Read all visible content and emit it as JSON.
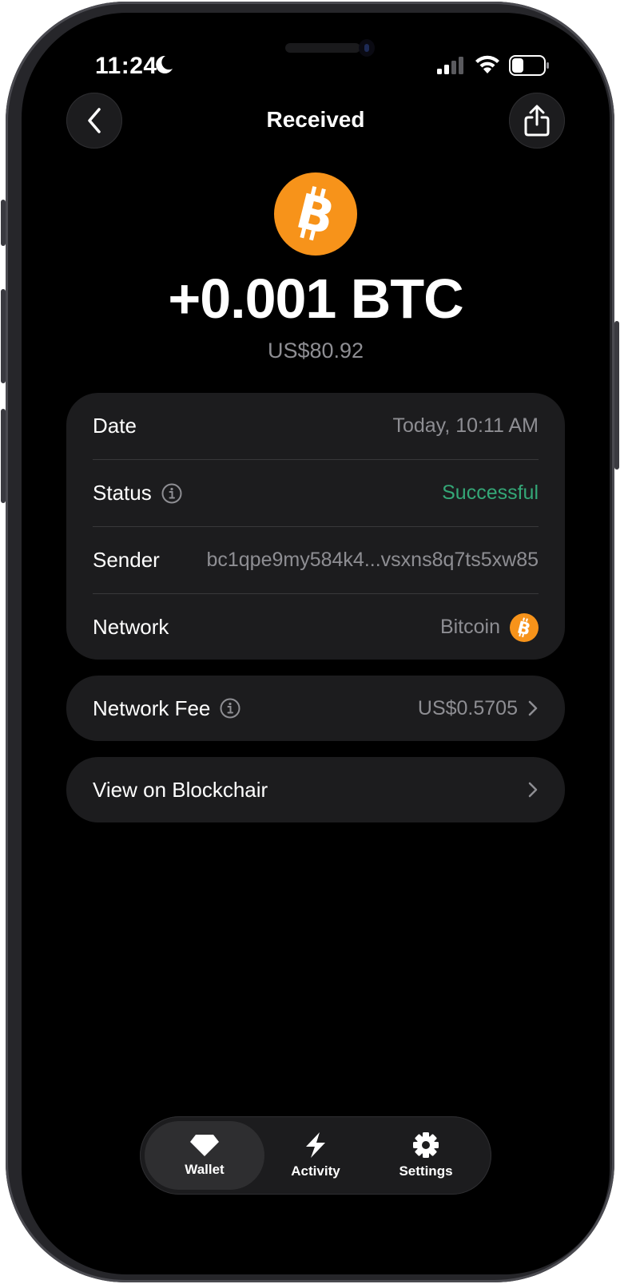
{
  "status_bar": {
    "time": "11:24"
  },
  "nav": {
    "title": "Received"
  },
  "transaction": {
    "amount": "+0.001 BTC",
    "fiat": "US$80.92"
  },
  "details": [
    {
      "label": "Date",
      "value": "Today, 10:11 AM"
    },
    {
      "label": "Status",
      "value": "Successful"
    },
    {
      "label": "Sender",
      "value": "bc1qpe9my584k4...vsxns8q7ts5xw85"
    },
    {
      "label": "Network",
      "value": "Bitcoin"
    }
  ],
  "network_fee": {
    "label": "Network Fee",
    "value": "US$0.5705"
  },
  "explorer": {
    "label": "View on Blockchair"
  },
  "tabs": [
    {
      "label": "Wallet",
      "icon": "diamond-icon",
      "active": true
    },
    {
      "label": "Activity",
      "icon": "bolt-icon",
      "active": false
    },
    {
      "label": "Settings",
      "icon": "gear-icon",
      "active": false
    }
  ],
  "colors": {
    "background": "#000000",
    "card": "#1c1c1e",
    "bitcoin": "#F7931A",
    "success": "#34a777",
    "secondary_text": "#8e8e93"
  }
}
